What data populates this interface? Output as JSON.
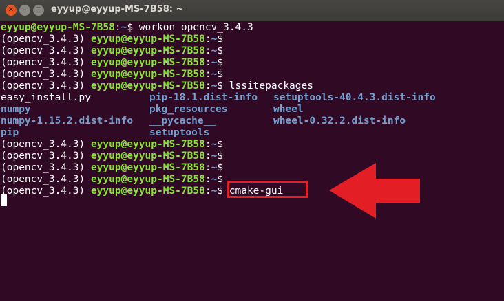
{
  "window": {
    "title": "eyyup@eyyup-MS-7B58: ~",
    "close_glyph": "✕",
    "min_glyph": "–",
    "max_glyph": "□"
  },
  "prompt": {
    "env": "(opencv_3.4.3) ",
    "user_host": "eyyup@eyyup-MS-7B58",
    "separator": ":",
    "path": "~",
    "symbol": "$"
  },
  "commands": {
    "workon": " workon opencv_3.4.3",
    "lssitepackages": " lssitepackages",
    "cmake_gui": " cmake-gui"
  },
  "listing": {
    "row1": [
      "easy_install.py",
      "pip-18.1.dist-info",
      "setuptools-40.4.3.dist-info"
    ],
    "row2": [
      "numpy",
      "pkg_resources",
      "wheel"
    ],
    "row3": [
      "numpy-1.15.2.dist-info",
      "__pycache__",
      "wheel-0.32.2.dist-info"
    ],
    "row4": [
      "pip",
      "setuptools"
    ]
  },
  "annotation": {
    "box_color": "#e31e24",
    "arrow_color": "#e31e24",
    "arrow_direction": "left"
  }
}
